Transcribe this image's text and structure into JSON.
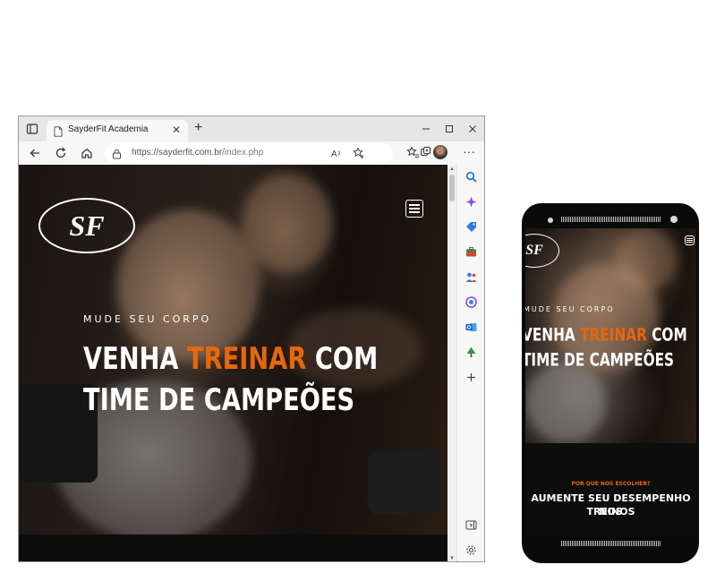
{
  "browser": {
    "tab_title": "SayderFit Academia",
    "new_tab_symbol": "+",
    "close_symbol": "✕",
    "url_host": "https://sayderfit.com.br",
    "url_path": "/index.php",
    "more_symbol": "···",
    "icons": {
      "tab_actions": "tab-actions-icon",
      "favicon": "document-icon",
      "back": "arrow-left-icon",
      "refresh": "refresh-icon",
      "home": "home-icon",
      "site_info": "lock-icon",
      "read_aloud": "read-aloud-icon",
      "add_favorite": "star-plus-icon",
      "favorites": "star-list-icon",
      "collections": "collections-icon",
      "profile": "avatar-icon",
      "sidebar": [
        "search-icon",
        "copilot-icon",
        "tag-icon",
        "briefcase-icon",
        "people-icon",
        "office-icon",
        "outlook-icon",
        "tree-icon",
        "plus-icon",
        "sidebar-toggle-icon",
        "gear-icon"
      ]
    }
  },
  "site": {
    "logo_text": "SF",
    "kicker": "MUDE SEU CORPO",
    "headline_line1_pre": "VENHA ",
    "headline_line1_accent": "TREINAR",
    "headline_line1_post": " COM",
    "headline_line2": "TIME DE CAMPEÕES",
    "why_kicker": "POR QUE NOS ESCOLHER?",
    "why_title_line1": "AUMENTE SEU DESEMPENHO NOS",
    "why_title_line2": "TREINOS"
  },
  "colors": {
    "accent": "#e8660a",
    "text": "#ffffff",
    "dark": "#0d0d0d"
  }
}
